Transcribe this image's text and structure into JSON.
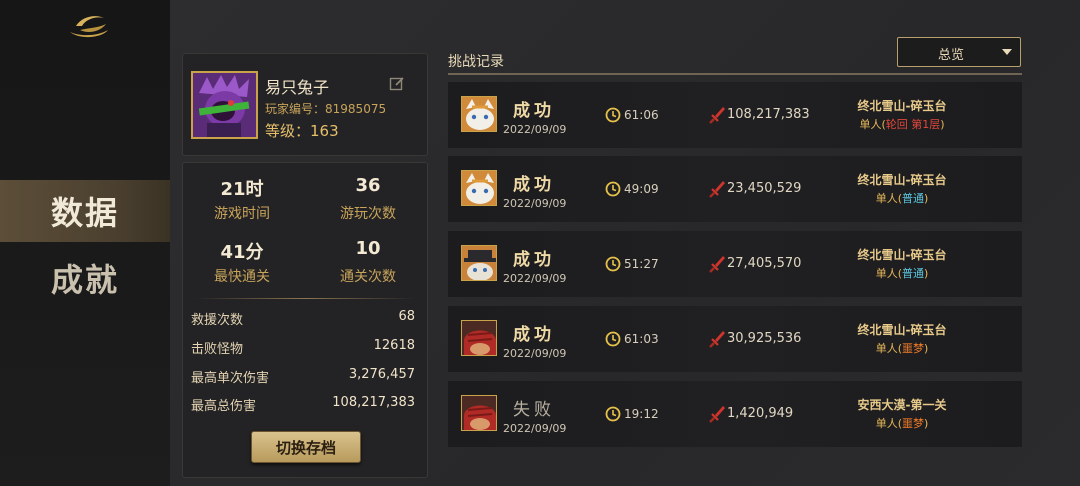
{
  "nav": {
    "items": [
      {
        "label": "数据",
        "active": true
      },
      {
        "label": "成就",
        "active": false
      }
    ]
  },
  "profile": {
    "name": "易只兔子",
    "id_label": "玩家编号：",
    "id_value": "81985075",
    "level_label": "等级：",
    "level_value": "163"
  },
  "stats": {
    "grid": [
      {
        "value": "21时",
        "label": "游戏时间"
      },
      {
        "value": "36",
        "label": "游玩次数"
      },
      {
        "value": "41分",
        "label": "最快通关"
      },
      {
        "value": "10",
        "label": "通关次数"
      }
    ],
    "rows": [
      {
        "key": "救援次数",
        "value": "68"
      },
      {
        "key": "击败怪物",
        "value": "12618"
      },
      {
        "key": "最高单次伤害",
        "value": "3,276,457"
      },
      {
        "key": "最高总伤害",
        "value": "108,217,383"
      }
    ],
    "switch_button": "切换存档"
  },
  "records": {
    "title": "挑战记录",
    "filter": "总览",
    "items": [
      {
        "result": "成功",
        "date": "2022/09/09",
        "time": "61:06",
        "damage": "108,217,383",
        "map": "终北雪山-碎玉台",
        "mode_prefix": "单人(",
        "mode_detail": "轮回 第1层",
        "mode_suffix": ")",
        "mode_color": "red",
        "success": true,
        "avatar_style": "cat-white"
      },
      {
        "result": "成功",
        "date": "2022/09/09",
        "time": "49:09",
        "damage": "23,450,529",
        "map": "终北雪山-碎玉台",
        "mode_prefix": "单人(",
        "mode_detail": "普通",
        "mode_suffix": ")",
        "mode_color": "blue",
        "success": true,
        "avatar_style": "cat-white"
      },
      {
        "result": "成功",
        "date": "2022/09/09",
        "time": "51:27",
        "damage": "27,405,570",
        "map": "终北雪山-碎玉台",
        "mode_prefix": "单人(",
        "mode_detail": "普通",
        "mode_suffix": ")",
        "mode_color": "blue",
        "success": true,
        "avatar_style": "cat-hat"
      },
      {
        "result": "成功",
        "date": "2022/09/09",
        "time": "61:03",
        "damage": "30,925,536",
        "map": "终北雪山-碎玉台",
        "mode_prefix": "单人(",
        "mode_detail": "噩梦",
        "mode_suffix": ")",
        "mode_color": "orange",
        "success": true,
        "avatar_style": "red-hood"
      },
      {
        "result": "失败",
        "date": "2022/09/09",
        "time": "19:12",
        "damage": "1,420,949",
        "map": "安西大漠-第一关",
        "mode_prefix": "单人(",
        "mode_detail": "噩梦",
        "mode_suffix": ")",
        "mode_color": "orange",
        "success": false,
        "avatar_style": "red-hood"
      }
    ]
  },
  "colors": {
    "accent_gold": "#c9a24a",
    "panel_bg": "#232325",
    "mode_red": "#e2473c",
    "mode_blue": "#5cc9e0",
    "mode_orange": "#f07a28"
  }
}
